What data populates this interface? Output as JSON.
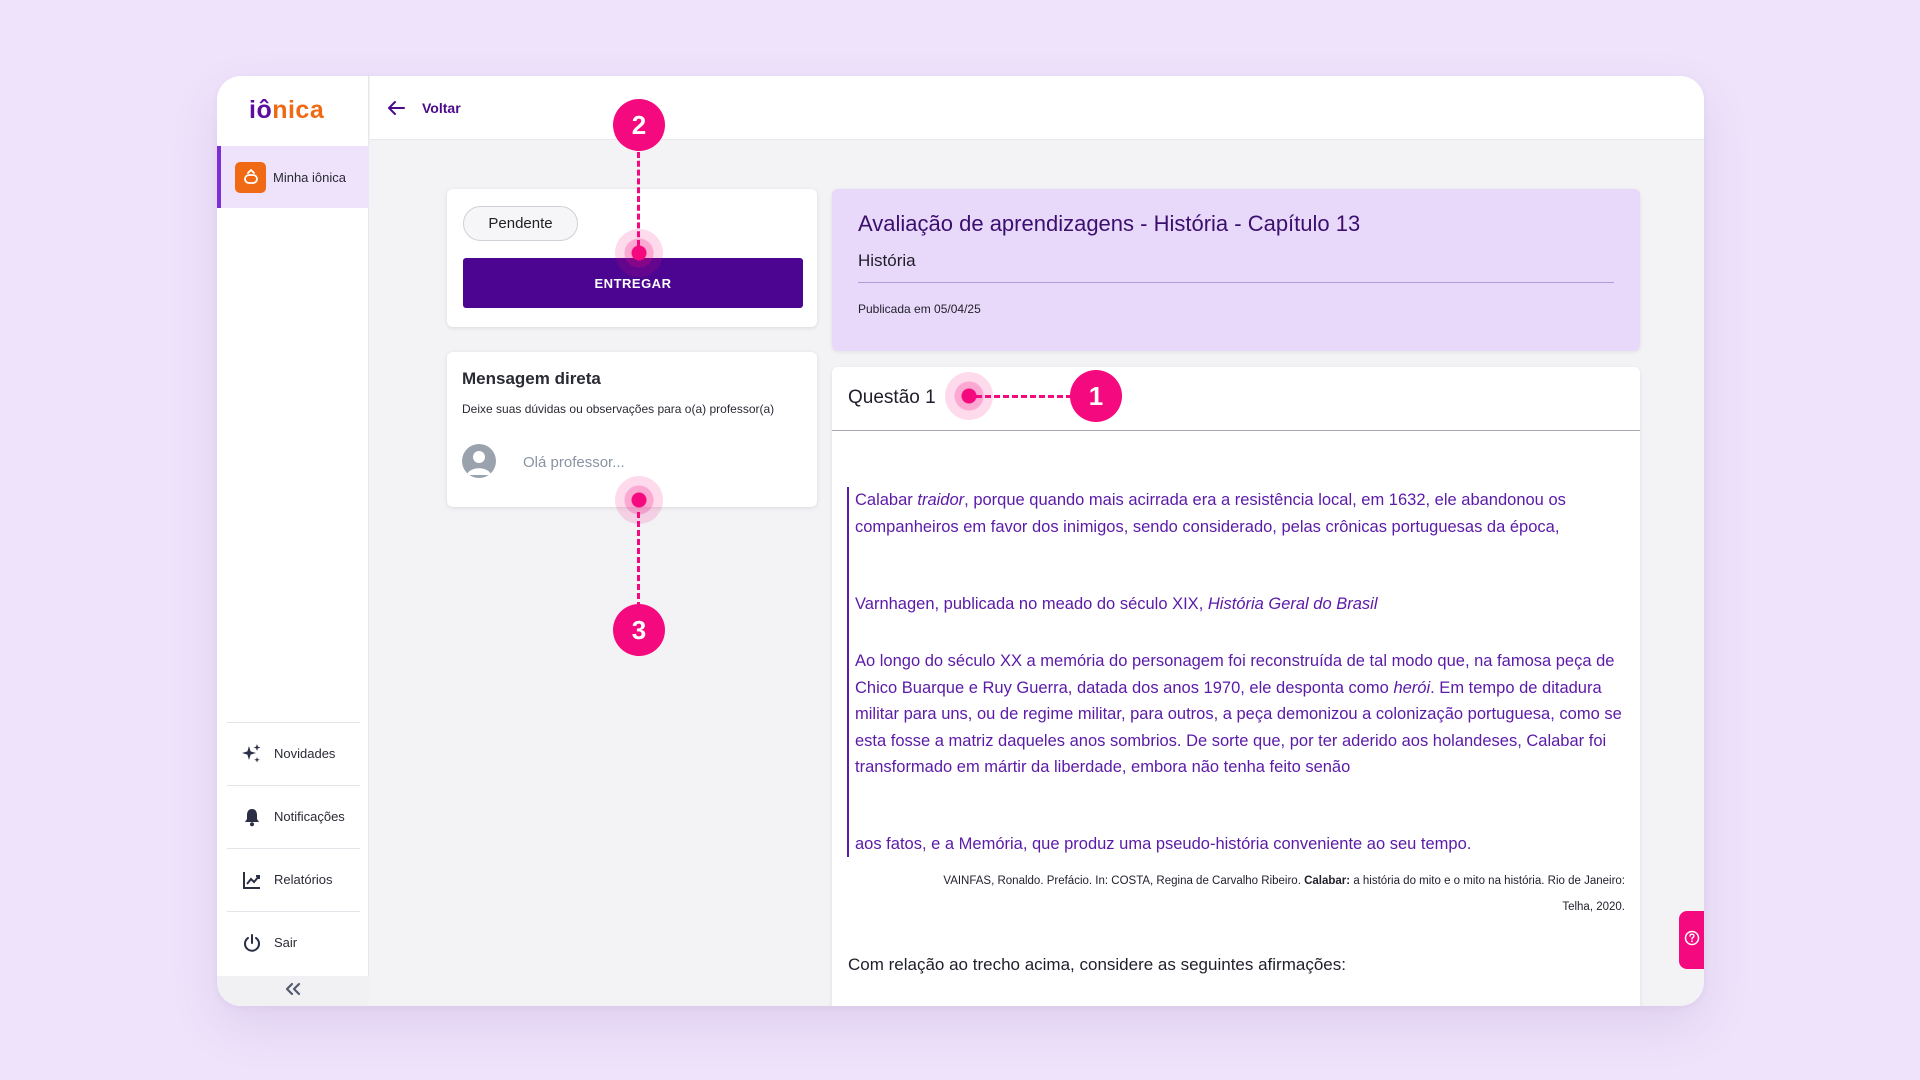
{
  "app": {
    "logo_part1": "iô",
    "logo_part2": "nica"
  },
  "sidebar": {
    "active_item": {
      "label": "Minha iônica",
      "icon": "home-icon"
    },
    "items": [
      {
        "label": "Novidades",
        "icon": "sparkles-icon"
      },
      {
        "label": "Notificações",
        "icon": "bell-icon"
      },
      {
        "label": "Relatórios",
        "icon": "chart-icon"
      },
      {
        "label": "Sair",
        "icon": "power-icon"
      }
    ],
    "collapse_icon": "double-chevron-left-icon"
  },
  "topbar": {
    "back_label": "Voltar"
  },
  "status_card": {
    "status": "Pendente",
    "submit_label": "ENTREGAR"
  },
  "message_card": {
    "title": "Mensagem direta",
    "subtitle": "Deixe suas dúvidas ou observações para o(a) professor(a)",
    "placeholder": "Olá professor..."
  },
  "assessment": {
    "title": "Avaliação de aprendizagens - História - Capítulo 13",
    "subject": "História",
    "published": "Publicada em 05/04/25"
  },
  "question": {
    "title": "Questão 1",
    "quote": {
      "p1_a": "Calabar ",
      "p1_em": "traidor",
      "p1_b": ", porque quando mais acirrada era a resistência local, em 1632, ele abandonou os companheiros em favor dos inimigos, sendo considerado, pelas crônicas portuguesas da época,",
      "p2_a": "Varnhagen, publicada no meado do século XIX, ",
      "p2_em": "História Geral do Brasil",
      "p3_a": "Ao longo do século XX a memória do personagem foi reconstruída de tal modo que, na famosa peça de Chico Buarque e Ruy Guerra, datada dos anos 1970, ele desponta como ",
      "p3_em": "herói",
      "p3_b": ". Em tempo de ditadura militar para uns, ou de regime militar, para outros, a peça demonizou a colonização portuguesa, como se esta fosse a matriz daqueles anos sombrios. De sorte que, por ter aderido aos holandeses, Calabar foi transformado em mártir da liberdade, embora não tenha feito senão",
      "p4": "aos fatos, e a Memória, que produz uma pseudo-história conveniente ao seu tempo."
    },
    "reference_a": "VAINFAS, Ronaldo. Prefácio. In: COSTA, Regina de Carvalho Ribeiro. ",
    "reference_bold": "Calabar:",
    "reference_b": " a história do mito e o mito na história. Rio de Janeiro:",
    "reference_c": "Telha, 2020.",
    "prompt": "Com relação ao trecho acima, considere as seguintes afirmações:"
  },
  "help_icon": "help-circle-icon",
  "callouts": [
    "1",
    "2",
    "3"
  ],
  "colors": {
    "brand_purple": "#4b0590",
    "brand_orange": "#f06a15",
    "callout_pink": "#f4097e",
    "header_bg": "#e8d8fa",
    "quote_text": "#5b1aa8"
  }
}
